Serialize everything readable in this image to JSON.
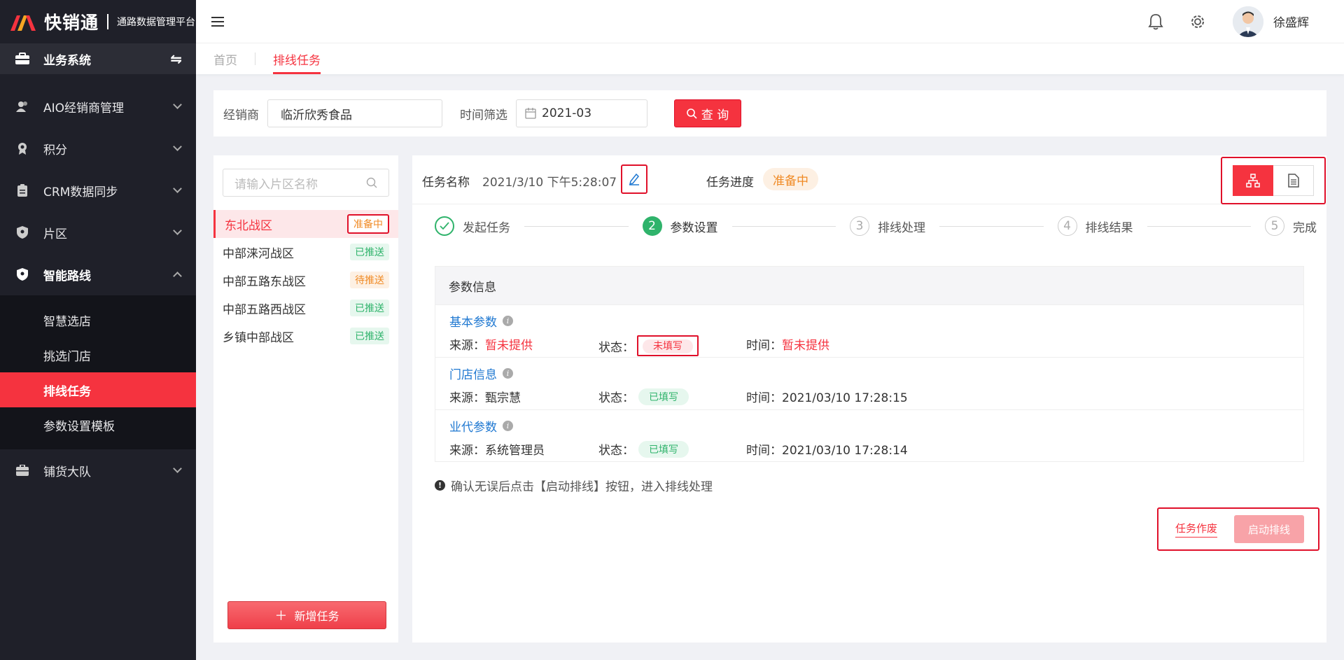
{
  "app": {
    "name": "快销通",
    "subtitle": "通路数据管理平台",
    "system_label": "业务系统",
    "accent_color": "#f5333f"
  },
  "sidebar": {
    "items": [
      {
        "label": "AIO经销商管理",
        "icon": "people-icon"
      },
      {
        "label": "积分",
        "icon": "award-icon"
      },
      {
        "label": "CRM数据同步",
        "icon": "clipboard-icon"
      },
      {
        "label": "片区",
        "icon": "shield-icon"
      },
      {
        "label": "智能路线",
        "icon": "shield-check-icon",
        "open": true
      },
      {
        "label": "铺货大队",
        "icon": "briefcase-icon"
      }
    ],
    "submenu": [
      "智慧选店",
      "挑选门店",
      "排线任务",
      "参数设置模板"
    ],
    "active_sub": "排线任务"
  },
  "header": {
    "user_name": "徐盛辉",
    "icons": [
      "bell-icon",
      "gear-icon"
    ]
  },
  "tabs": [
    {
      "label": "首页",
      "active": false
    },
    {
      "label": "排线任务",
      "active": true
    }
  ],
  "filter": {
    "dealer_label": "经销商",
    "dealer_value": "临沂欣秀食品",
    "time_label": "时间筛选",
    "time_value": "2021-03",
    "query_button": "查 询"
  },
  "zones": {
    "search_placeholder": "请输入片区名称",
    "items": [
      {
        "name": "东北战区",
        "status": "准备中",
        "tone": "red"
      },
      {
        "name": "中部涞河战区",
        "status": "已推送",
        "tone": "green"
      },
      {
        "name": "中部五路东战区",
        "status": "待推送",
        "tone": "orange"
      },
      {
        "name": "中部五路西战区",
        "status": "已推送",
        "tone": "green"
      },
      {
        "name": "乡镇中部战区",
        "status": "已推送",
        "tone": "green"
      }
    ],
    "add_button": "新增任务"
  },
  "task": {
    "name_label": "任务名称",
    "name_value": "2021/3/10 下午5:28:07",
    "progress_label": "任务进度",
    "progress_value": "准备中"
  },
  "steps": [
    {
      "num": "",
      "label": "发起任务",
      "state": "done"
    },
    {
      "num": "2",
      "label": "参数设置",
      "state": "current"
    },
    {
      "num": "3",
      "label": "排线处理",
      "state": "pending"
    },
    {
      "num": "4",
      "label": "排线结果",
      "state": "pending"
    },
    {
      "num": "5",
      "label": "完成",
      "state": "pending"
    }
  ],
  "params": {
    "title": "参数信息",
    "source_label": "来源：",
    "state_label": "状态：",
    "time_label": "时间：",
    "rows": [
      {
        "title": "基本参数",
        "source": "暂未提供",
        "state": "未填写",
        "time": "暂未提供",
        "missing": true
      },
      {
        "title": "门店信息",
        "source": "甄宗慧",
        "state": "已填写",
        "time": "2021/03/10 17:28:15",
        "missing": false
      },
      {
        "title": "业代参数",
        "source": "系统管理员",
        "state": "已填写",
        "time": "2021/03/10 17:28:14",
        "missing": false
      }
    ]
  },
  "tip": "确认无误后点击【启动排线】按钮，进入排线处理",
  "actions": {
    "void_button": "任务作废",
    "start_button": "启动排线"
  }
}
